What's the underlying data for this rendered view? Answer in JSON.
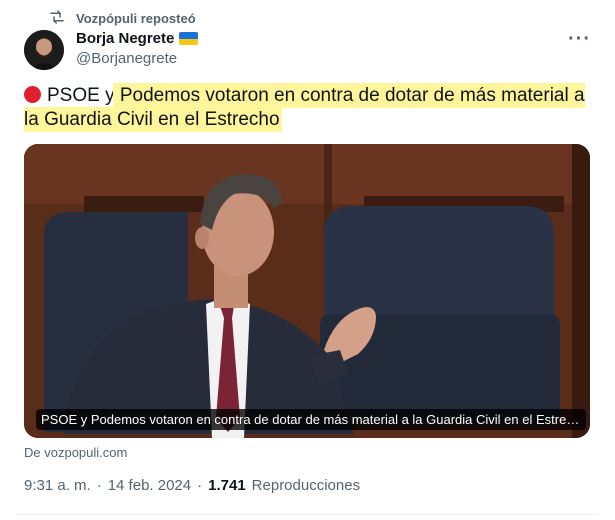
{
  "repost": {
    "label": "Vozpópuli reposteó",
    "icon": "repost-icon"
  },
  "author": {
    "name": "Borja Negrete",
    "handle": "@Borjanegrete",
    "flag": "ukraine-flag-emoji"
  },
  "menu": {
    "icon": "more-icon",
    "label": "···"
  },
  "tweet": {
    "emoji": "red-circle-emoji",
    "text_plain": "PSOE y",
    "text_highlight": " Podemos votaron en contra de dotar de más material a la Guardia Civil en el Estrecho"
  },
  "card": {
    "caption": "PSOE y Podemos votaron en contra de dotar de más material a la Guardia Civil en el Estrecho",
    "source": "De vozpopuli.com"
  },
  "meta": {
    "time": "9:31 a. m.",
    "separator": "·",
    "date": "14 feb. 2024",
    "views": "1.741",
    "views_label": "Reproducciones"
  },
  "colors": {
    "secondary_text": "#536471",
    "highlight": "#fff59a",
    "red_dot": "#e0202f"
  }
}
